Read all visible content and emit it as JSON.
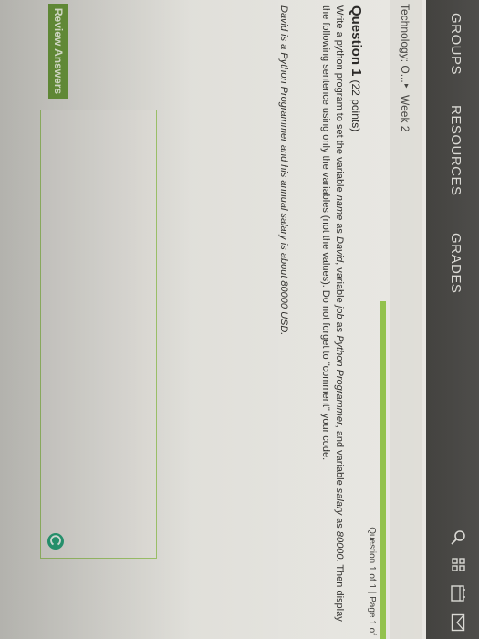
{
  "nav": {
    "items": [
      "GROUPS",
      "RESOURCES",
      "GRADES"
    ],
    "icons": [
      "search-icon",
      "grid-icon",
      "calendar-icon",
      "mail-icon"
    ]
  },
  "breadcrumb": {
    "course": "Technology: O...",
    "separator": "▸",
    "week": "Week 2"
  },
  "question": {
    "counter": "Question 1 of 1 | Page 1 of",
    "title": "Question 1",
    "points": "(22 points)",
    "prompt_parts": [
      "Write a python program to set the variable ",
      "name",
      " as ",
      "David",
      ", variable ",
      "job",
      " as ",
      "Python Programmer",
      ", and variable ",
      "salary",
      " as ",
      "80000",
      ". Then display the following sentence using only the variables (not the values). Do not forget to \"comment\" your code."
    ],
    "sample_sentence": "David is a Python Programmer and his annual salary is about 80000 USD.",
    "answer_value": ""
  },
  "actions": {
    "review_label": "Review Answers"
  },
  "colors": {
    "topbar": "#3a3936",
    "accent_green": "#8fc046",
    "button_green": "#6d9b3d",
    "check_teal": "#2aa37a"
  }
}
